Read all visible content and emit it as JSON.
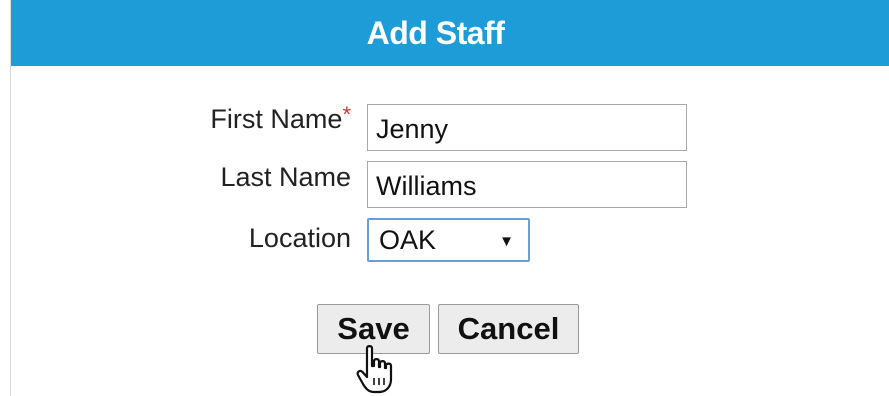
{
  "dialog": {
    "title": "Add Staff"
  },
  "form": {
    "first_name": {
      "label": "First Name",
      "required_mark": "*",
      "value": "Jenny"
    },
    "last_name": {
      "label": "Last Name",
      "value": "Williams"
    },
    "location": {
      "label": "Location",
      "selected": "OAK"
    }
  },
  "buttons": {
    "save": "Save",
    "cancel": "Cancel"
  },
  "colors": {
    "header_bg": "#1e9cd7",
    "header_text": "#ffffff",
    "required_mark": "#c0392b",
    "select_focus_border": "#6a9fd4",
    "button_bg": "#ececec"
  },
  "icons": {
    "select_arrow": "triangle-down",
    "cursor": "hand-pointer"
  }
}
